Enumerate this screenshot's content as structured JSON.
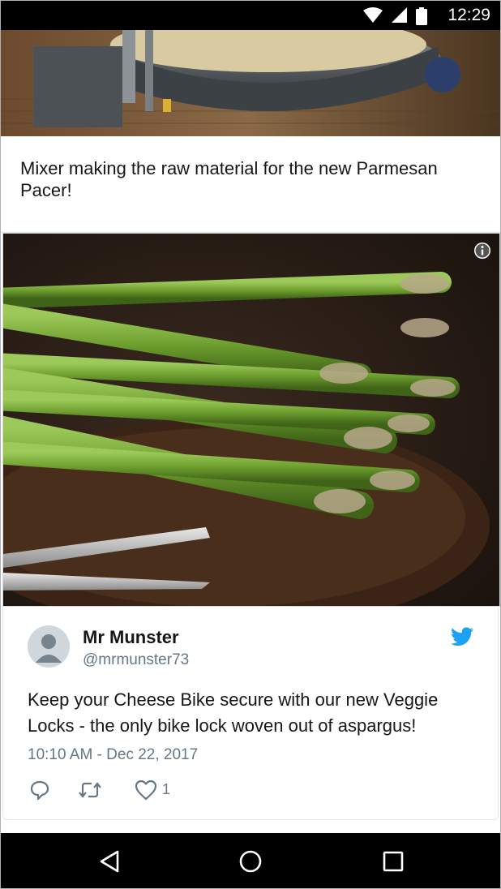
{
  "status_bar": {
    "time": "12:29",
    "icons": [
      "wifi-icon",
      "cell-signal-icon",
      "battery-icon"
    ]
  },
  "top_photo": {
    "subject": "Mixer making the raw material"
  },
  "caption": {
    "text": "Mixer making the raw material for the new Parmesan Pacer!"
  },
  "main_photo": {
    "info_icon": "info-icon"
  },
  "tweet": {
    "display_name": "Mr Munster",
    "handle": "@mrmunster73",
    "text": "Keep your Cheese Bike secure with our new Veggie Locks - the only bike lock woven out of aspargus!",
    "timestamp": "10:10 AM - Dec 22, 2017",
    "like_count": "1",
    "brand_icon": "twitter-bird-icon",
    "actions": [
      "reply-icon",
      "retweet-icon",
      "like-icon"
    ]
  },
  "nav_bar": {
    "buttons": [
      "back-icon",
      "home-icon",
      "recents-icon"
    ]
  },
  "colors": {
    "twitter_blue": "#1da1f2",
    "text_primary": "#14171a",
    "text_secondary": "#657786",
    "system_bar": "#000000"
  }
}
